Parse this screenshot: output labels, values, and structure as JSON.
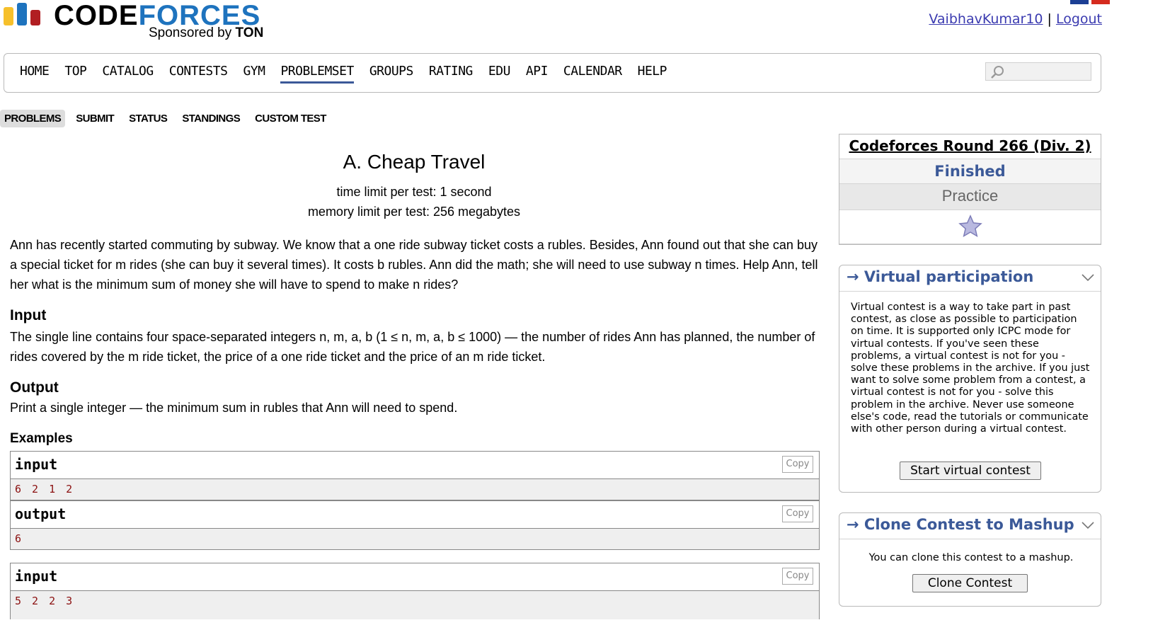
{
  "header": {
    "logo": {
      "code": "CODE",
      "forces": "FORCES",
      "sponsored_prefix": "Sponsored by ",
      "sponsor": "TON"
    },
    "user": {
      "username": "VaibhavKumar10",
      "separator": "|",
      "logout": "Logout"
    },
    "flag_colors": [
      "#1c3f94",
      "#d52b1e"
    ]
  },
  "menu": {
    "items": [
      "HOME",
      "TOP",
      "CATALOG",
      "CONTESTS",
      "GYM",
      "PROBLEMSET",
      "GROUPS",
      "RATING",
      "EDU",
      "API",
      "CALENDAR",
      "HELP"
    ],
    "active": "PROBLEMSET",
    "search_icon": "magnifier-icon"
  },
  "submenu": {
    "items": [
      "PROBLEMS",
      "SUBMIT",
      "STATUS",
      "STANDINGS",
      "CUSTOM TEST"
    ],
    "active": "PROBLEMS"
  },
  "problem": {
    "title": "A. Cheap Travel",
    "time_limit": "time limit per test: 1 second",
    "memory_limit": "memory limit per test: 256 megabytes",
    "statement": "Ann has recently started commuting by subway. We know that a one ride subway ticket costs a rubles. Besides, Ann found out that she can buy a special ticket for m rides (she can buy it several times). It costs b rubles. Ann did the math; she will need to use subway n times. Help Ann, tell her what is the minimum sum of money she will have to spend to make n rides?",
    "input_title": "Input",
    "input_spec": "The single line contains four space-separated integers n, m, a, b (1 ≤ n, m, a, b ≤ 1000) — the number of rides Ann has planned, the number of rides covered by the m ride ticket, the price of a one ride ticket and the price of an m ride ticket.",
    "output_title": "Output",
    "output_spec": "Print a single integer — the minimum sum in rubles that Ann will need to spend.",
    "examples_title": "Examples",
    "examples": [
      {
        "label": "input",
        "copy": "Copy",
        "value": "6 2 1 2"
      },
      {
        "label": "output",
        "copy": "Copy",
        "value": "6"
      },
      {
        "label": "input",
        "copy": "Copy",
        "value": "5 2 2 3"
      }
    ]
  },
  "sidebar": {
    "round": {
      "name": "Codeforces Round 266 (Div. 2)",
      "status": "Finished",
      "mode": "Practice",
      "star_icon": "star-icon"
    },
    "virtual": {
      "title": "→ Virtual participation",
      "text": "Virtual contest is a way to take part in past contest, as close as possible to participation on time. It is supported only ICPC mode for virtual contests. If you've seen these problems, a virtual contest is not for you - solve these problems in the archive. If you just want to solve some problem from a contest, a virtual contest is not for you - solve this problem in the archive. Never use someone else's code, read the tutorials or communicate with other person during a virtual contest.",
      "button": "Start virtual contest"
    },
    "clone": {
      "title": "→ Clone Contest to Mashup",
      "text": "You can clone this contest to a mashup.",
      "button": "Clone Contest"
    },
    "colors": {
      "link": "#3b5998",
      "accent": "#1e73be"
    }
  }
}
